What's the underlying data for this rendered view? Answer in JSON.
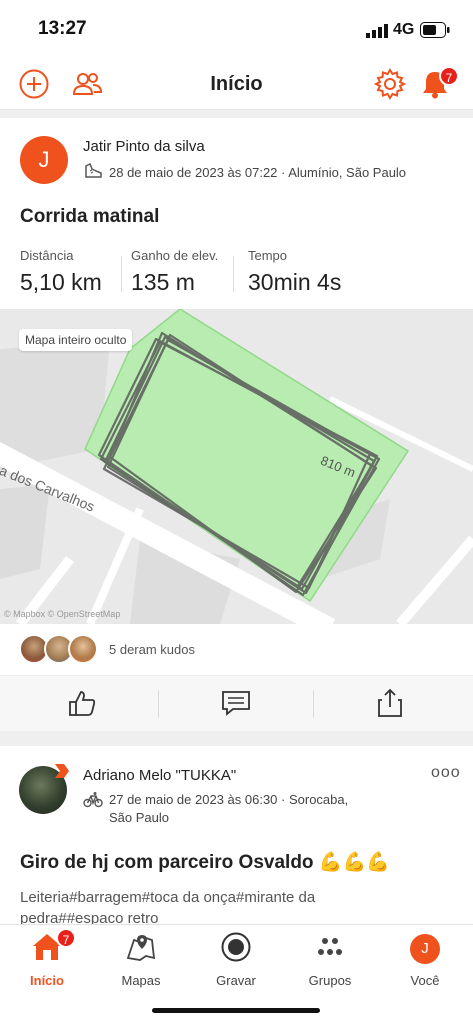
{
  "status": {
    "time": "13:27",
    "network": "4G"
  },
  "header": {
    "title": "Início",
    "notifications_count": "7"
  },
  "post1": {
    "avatar_initial": "J",
    "athlete": "Jatir Pinto da silva",
    "datetime_location": "28 de maio de 2023 às 07:22 · Alumínio, São Paulo",
    "title": "Corrida matinal",
    "stats": [
      {
        "label": "Distância",
        "value": "5,10 km"
      },
      {
        "label": "Ganho de elev.",
        "value": "135 m"
      },
      {
        "label": "Tempo",
        "value": "30min 4s"
      }
    ],
    "map": {
      "chip": "Mapa inteiro oculto",
      "street": "ua dos Carvalhos",
      "distance_marker": "810 m",
      "attribution": "© Mapbox © OpenStreetMap"
    },
    "kudos": "5 deram kudos",
    "icons": [
      "running-shoe-icon",
      "thumbs-up-icon",
      "comment-icon",
      "share-icon"
    ]
  },
  "post2": {
    "athlete": "Adriano Melo \"TUKKA\"",
    "more": "ooo",
    "datetime_line1": "27 de maio de 2023 às 06:30 · Sorocaba,",
    "datetime_line2": "São Paulo",
    "title": "Giro de hj com parceiro Osvaldo 💪💪💪",
    "description": "Leiteria#barragem#toca da onça#mirante da pedra##espaco retro"
  },
  "tabbar": {
    "home_badge": "7",
    "tabs": [
      {
        "label": "Início"
      },
      {
        "label": "Mapas"
      },
      {
        "label": "Gravar"
      },
      {
        "label": "Grupos"
      },
      {
        "label": "Você",
        "avatar": "J"
      }
    ]
  },
  "colors": {
    "accent": "#f0521e",
    "badge": "#e8201a",
    "map_area": "#b8ecb0",
    "route": "#555555"
  }
}
